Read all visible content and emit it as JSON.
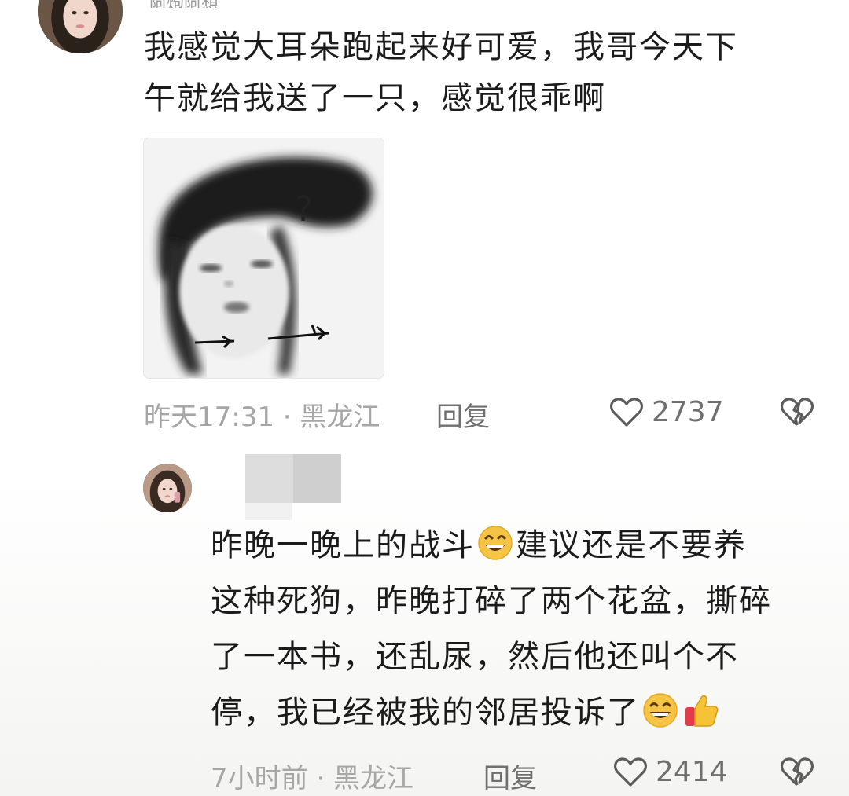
{
  "comment1": {
    "username": "阿炮阿想",
    "text_line1": "我感觉大耳朵跑起来好可爱，我哥今天下",
    "text_line2": "午就给我送了一只，感觉很乖啊",
    "image_icon": "sketch-face-question-image",
    "time_location": "昨天17:31 · 黑龙江",
    "reply_label": "回复",
    "like_count": "2737",
    "like_icon": "heart-outline-icon",
    "dislike_icon": "broken-heart-icon"
  },
  "comment2": {
    "text_line1_a": "昨晚一晚上的战斗",
    "text_line1_b": "建议还是不要养",
    "text_line2": "这种死狗，昨晚打碎了两个花盆，撕碎",
    "text_line3": "了一本书，还乱尿，然后他还叫个不",
    "text_line4": "停，我已经被我的邻居投诉了",
    "emoji_1": "grinning-sweat-emoji",
    "emoji_2": "thumbs-up-emoji",
    "time_location": "7小时前 · 黑龙江",
    "reply_label": "回复",
    "like_count": "2414",
    "like_icon": "heart-outline-icon",
    "dislike_icon": "broken-heart-icon"
  },
  "colors": {
    "text_primary": "#1b1b1b",
    "text_meta": "#a6a6a6",
    "text_secondary": "#6f6f6f"
  }
}
